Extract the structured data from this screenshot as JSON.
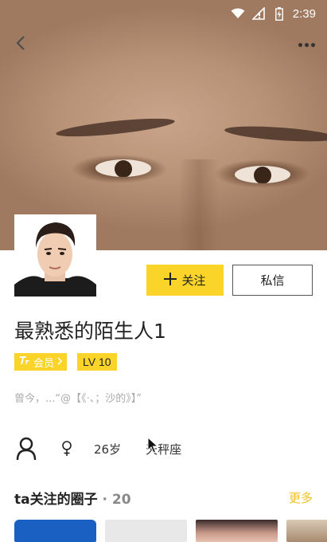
{
  "status_bar": {
    "time": "2:39"
  },
  "actions": {
    "follow_label": "关注",
    "message_label": "私信"
  },
  "profile": {
    "name": "最熟悉的陌生人1",
    "vip_label": "会员",
    "level": "LV 10",
    "bio": "曾今，...“@【《·、；沙的》】”",
    "age": "26岁",
    "zodiac": "天秤座"
  },
  "circles": {
    "title": "ta关注的圈子",
    "separator": "·",
    "count": "20",
    "more_label": "更多"
  },
  "colors": {
    "accent": "#fad428",
    "more_link": "#f4c021"
  }
}
